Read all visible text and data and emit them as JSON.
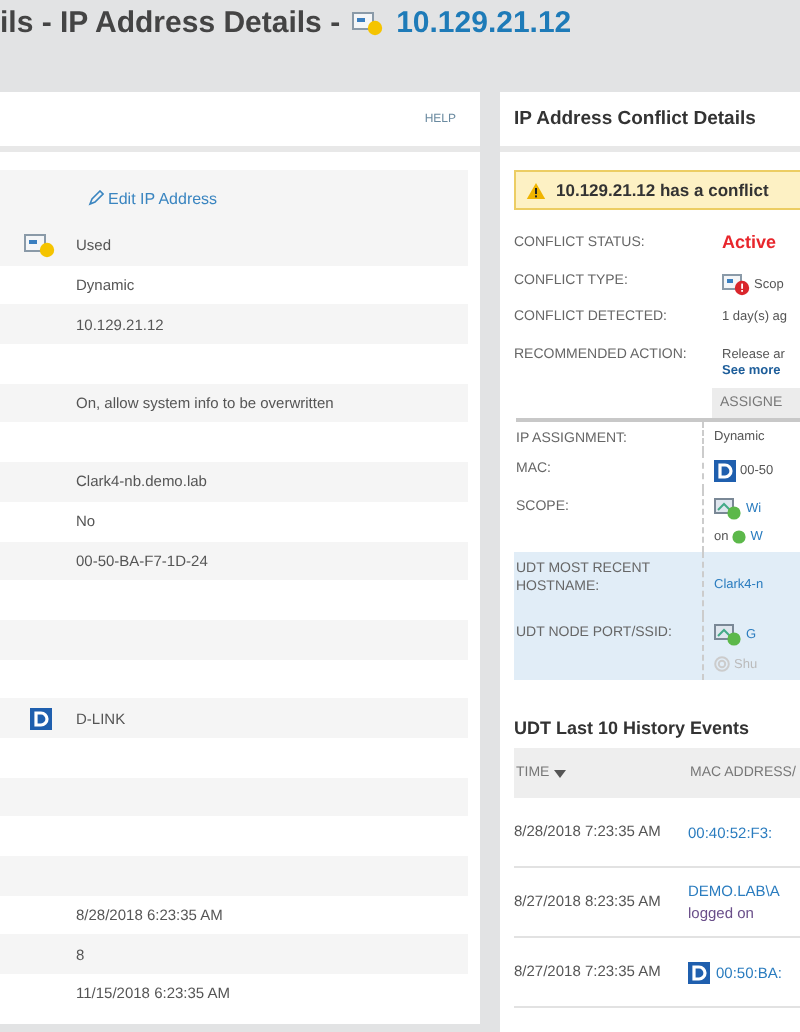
{
  "header": {
    "title": "ils - IP Address Details -",
    "address": "10.129.21.12"
  },
  "details_panel": {
    "help": "HELP",
    "edit_link": "Edit IP Address",
    "rows": [
      {
        "value": "Used",
        "kind": "ip"
      },
      {
        "value": "Dynamic"
      },
      {
        "value": "10.129.21.12"
      },
      {
        "value": ""
      },
      {
        "value": "On, allow system info to be overwritten"
      },
      {
        "value": ""
      },
      {
        "value": "Clark4-nb.demo.lab"
      },
      {
        "value": "No"
      },
      {
        "value": "00-50-BA-F7-1D-24"
      },
      {
        "value": ""
      },
      {
        "value": ""
      },
      {
        "value": ""
      },
      {
        "value": "D-LINK",
        "kind": "vendor"
      },
      {
        "value": ""
      },
      {
        "value": ""
      },
      {
        "value": ""
      },
      {
        "value": ""
      },
      {
        "value": "8/28/2018 6:23:35 AM"
      },
      {
        "value": "8"
      },
      {
        "value": "11/15/2018 6:23:35 AM"
      }
    ]
  },
  "conflict_panel": {
    "title": "IP Address Conflict Details",
    "alert": "10.129.21.12 has a conflict",
    "fields": [
      {
        "label": "CONFLICT STATUS:",
        "value": "Active",
        "kind": "status"
      },
      {
        "label": "CONFLICT TYPE:",
        "value": "Scop",
        "kind": "type"
      },
      {
        "label": "CONFLICT DETECTED:",
        "value": "1 day(s) ag",
        "kind": "text"
      },
      {
        "label": "RECOMMENDED ACTION:",
        "value": "Release ar",
        "link": "See more",
        "kind": "action"
      }
    ],
    "comparison": {
      "column": "ASSIGNE",
      "rows": [
        {
          "label": "IP ASSIGNMENT:",
          "kind": "text",
          "value": "Dynamic",
          "highlighted": false
        },
        {
          "label": "MAC:",
          "kind": "vendor",
          "value": "00-50",
          "highlighted": false
        },
        {
          "label": "SCOPE:",
          "kind": "scope",
          "value": "Wi",
          "sub_prefix": "on",
          "sub_value": "W",
          "highlighted": false
        },
        {
          "label": "UDT MOST RECENT HOSTNAME:",
          "kind": "link",
          "value": "Clark4-n",
          "highlighted": true
        },
        {
          "label": "UDT NODE PORT/SSID:",
          "kind": "port",
          "value": "G",
          "sub_value": "Shu",
          "highlighted": true
        }
      ]
    },
    "history": {
      "title": "UDT Last 10 History Events",
      "columns": [
        {
          "label": "TIME",
          "sorted": true
        },
        {
          "label": "MAC ADDRESS/",
          "sorted": false
        }
      ],
      "rows": [
        {
          "time": "8/28/2018 7:23:35 AM",
          "kind": "link",
          "value": "00:40:52:F3:"
        },
        {
          "time": "8/27/2018 8:23:35 AM",
          "kind": "user",
          "value": "DEMO.LAB\\A",
          "note": "logged on"
        },
        {
          "time": "8/27/2018 7:23:35 AM",
          "kind": "vendor",
          "value": "00:50:BA:"
        }
      ]
    }
  }
}
